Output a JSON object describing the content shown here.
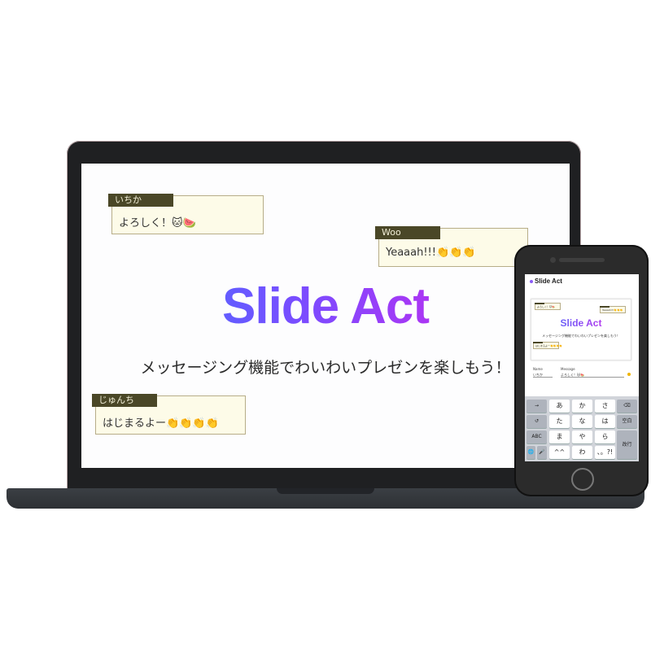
{
  "slide": {
    "title": "Slide Act",
    "subtitle": "メッセージング機能でわいわいプレゼンを楽しもう！"
  },
  "messages": [
    {
      "name": "いちか",
      "text": "よろしく！🐱🍉"
    },
    {
      "name": "Woo",
      "text": "Yeaaah!!!👏👏👏"
    },
    {
      "name": "じゅんち",
      "text": "はじまるよー👏👏👏👏"
    }
  ],
  "phone": {
    "app_title": "Slide Act",
    "slide_title": "Slide Act",
    "slide_subtitle": "メッセージング機能でわいわいプレゼンを楽しもう！",
    "mini_messages": [
      "よろしく！🐱🍉",
      "Yeaaah!!!👏👏👏",
      "はじまるよー👏👏👏👏"
    ],
    "form": {
      "name_label": "Name",
      "name_value": "いちか",
      "message_label": "Message",
      "message_value": "よろしく！🐱🍉"
    },
    "keyboard": {
      "row1": [
        "→",
        "あ",
        "か",
        "さ",
        "⌫"
      ],
      "row2": [
        "↺",
        "た",
        "な",
        "は",
        "空白"
      ],
      "row3": [
        "ABC",
        "ま",
        "や",
        "ら",
        "改行"
      ],
      "row4": [
        "🌐",
        "🎤",
        "^^",
        "わ",
        "、。?!"
      ]
    }
  }
}
